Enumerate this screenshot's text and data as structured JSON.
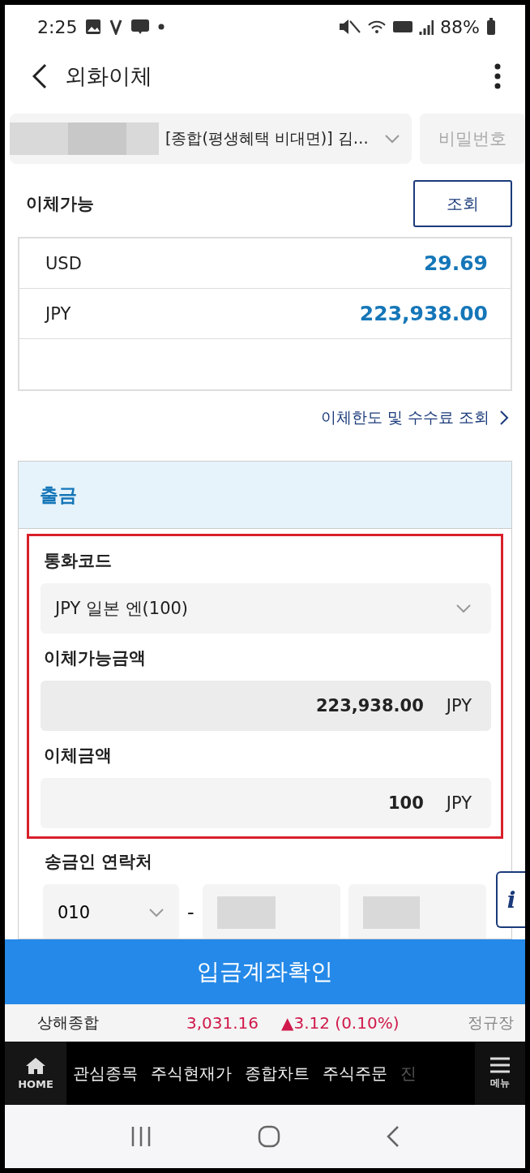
{
  "status_bar": {
    "time": "2:25",
    "battery": "88%"
  },
  "header": {
    "title": "외화이체"
  },
  "account": {
    "name": "[종합(평생혜택 비대면)]  김…",
    "password_placeholder": "비밀번호"
  },
  "available": {
    "title": "이체가능",
    "query_button": "조회",
    "rows": [
      {
        "currency": "USD",
        "amount": "29.69"
      },
      {
        "currency": "JPY",
        "amount": "223,938.00"
      }
    ],
    "link": "이체한도 및 수수료 조회"
  },
  "withdrawal": {
    "title": "출금",
    "highlighted": true,
    "currency_label": "통화코드",
    "currency_value": "JPY  일본 엔(100)",
    "available_label": "이체가능금액",
    "available_amount": "223,938.00",
    "available_unit": "JPY",
    "amount_label": "이체금액",
    "amount_value": "100",
    "amount_unit": "JPY"
  },
  "sender": {
    "label": "송금인 연락처",
    "prefix": "010",
    "separator": "-"
  },
  "info_button": "i",
  "confirm_button": "입금계좌확인",
  "ticker": {
    "name": "상해종합",
    "value": "3,031.16",
    "change": "▲3.12 (0.10%)",
    "session": "정규장"
  },
  "bottom_nav": {
    "home": "HOME",
    "items": [
      {
        "label": "관심종목",
        "faded": false
      },
      {
        "label": "주식현재가",
        "faded": false
      },
      {
        "label": "종합차트",
        "faded": false
      },
      {
        "label": "주식주문",
        "faded": false
      },
      {
        "label": "진",
        "faded": true
      }
    ],
    "menu": "메뉴"
  }
}
